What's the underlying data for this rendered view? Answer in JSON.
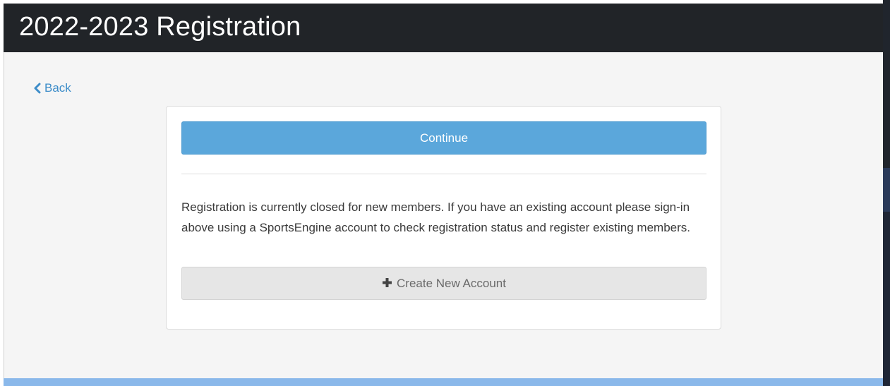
{
  "header": {
    "title": "2022-2023 Registration"
  },
  "nav": {
    "back_label": "Back"
  },
  "card": {
    "continue_label": "Continue",
    "notice_text": "Registration is currently closed for new members. If you have an existing account please sign-in above using a SportsEngine account to check registration status and register existing members.",
    "create_account_label": "Create New Account"
  },
  "icons": {
    "back": "chevron-left-icon",
    "create": "plus-icon"
  },
  "colors": {
    "header_bg": "#212428",
    "primary_button": "#5ba7db",
    "link": "#3d8dc9",
    "disabled_button": "#e6e6e6",
    "footer_accent": "#8ab8ea"
  }
}
